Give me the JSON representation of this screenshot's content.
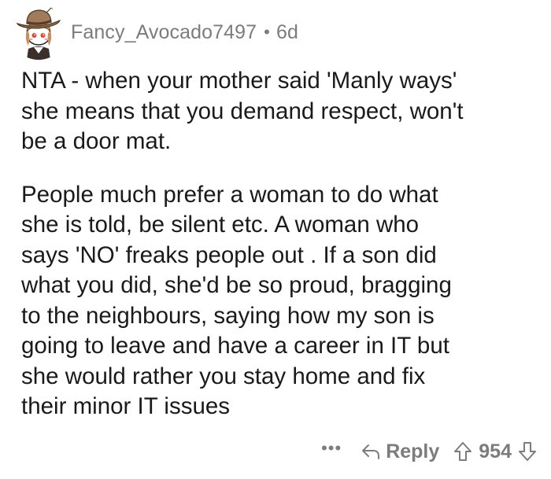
{
  "comment": {
    "username": "Fancy_Avocado7497",
    "separator": "•",
    "age": "6d",
    "avatar_icon": "snoo-avatar-cowboy-hat",
    "paragraphs": [
      "NTA - when your mother said 'Manly ways'\nshe means that you demand respect, won't\nbe a door mat.",
      "People much prefer a woman to do what\nshe is told, be silent etc.  A woman who\nsays 'NO' freaks people out .  If a son did\nwhat you did, she'd be so proud, bragging\nto the neighbours, saying how my son is\ngoing to leave and have a career in IT but\nshe would rather you stay home and fix\ntheir minor IT issues"
    ]
  },
  "actions": {
    "more_label": "•••",
    "reply_label": "Reply",
    "reply_icon": "reply-arrow-icon",
    "upvote_icon": "upvote-arrow-icon",
    "score": "954",
    "downvote_icon": "downvote-arrow-icon"
  },
  "colors": {
    "text": "#1a1a1b",
    "meta": "#7c7c7c",
    "background": "#ffffff"
  }
}
